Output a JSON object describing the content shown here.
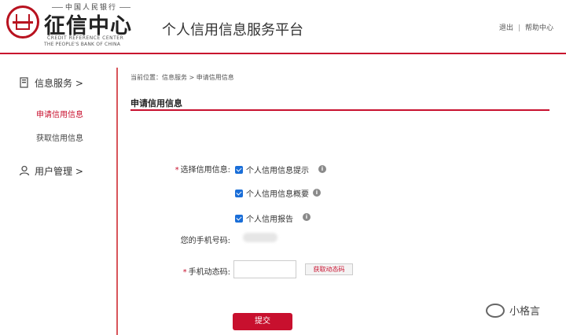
{
  "header": {
    "logo_small": "中国人民银行",
    "logo_big": "征信中心",
    "logo_en_line1": "CREDIT REFERENCE CENTER",
    "logo_en_line2": "THE PEOPLE'S BANK OF CHINA",
    "platform_title": "个人信用信息服务平台",
    "links": {
      "logout": "退出",
      "separator": "|",
      "help": "帮助中心"
    }
  },
  "sidebar": {
    "group_info": "信息服务 >",
    "items": [
      {
        "label": "申请信用信息",
        "active": true
      },
      {
        "label": "获取信用信息",
        "active": false
      }
    ],
    "group_user": "用户管理 >"
  },
  "main": {
    "breadcrumb": "当前位置：信息服务 > 申请信用信息",
    "section_title": "申请信用信息",
    "form": {
      "select_label": "选择信用信息:",
      "required_mark": "*",
      "options": [
        {
          "label": "个人信用信息提示",
          "checked": true
        },
        {
          "label": "个人信用信息概要",
          "checked": true
        },
        {
          "label": "个人信用报告",
          "checked": true
        }
      ],
      "phone_label": "您的手机号码:",
      "code_label": "手机动态码:",
      "code_value": "",
      "get_code_button": "获取动态码",
      "submit_button": "提交"
    }
  },
  "watermark": {
    "text": "小格言"
  },
  "colors": {
    "accent": "#c8102e",
    "checkbox": "#1a6ed8"
  }
}
